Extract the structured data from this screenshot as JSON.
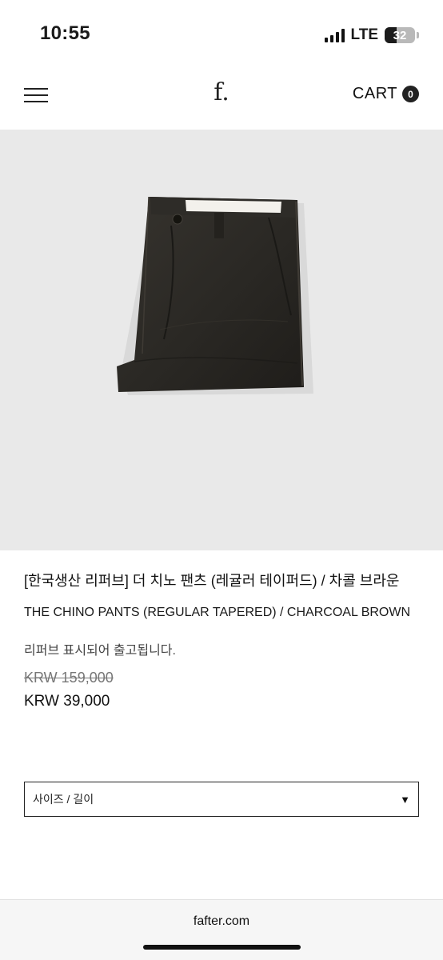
{
  "status_bar": {
    "time": "10:55",
    "network": "LTE",
    "battery": "32"
  },
  "header": {
    "menu_icon": "hamburger-menu-icon",
    "logo": "f.",
    "cart_label": "CART",
    "cart_count": "0"
  },
  "product": {
    "title_ko": "[한국생산 리퍼브] 더 치노 팬츠 (레귤러 테이퍼드) / 차콜 브라운",
    "title_en": "THE CHINO PANTS (REGULAR TAPERED) / CHARCOAL BROWN",
    "notice": "리퍼브 표시되어 출고됩니다.",
    "original_price": "KRW 159,000",
    "sale_price": "KRW 39,000",
    "option_select": {
      "label": "사이즈 / 길이",
      "arrow": "▼"
    }
  },
  "footer": {
    "domain": "fafter.com"
  },
  "colors": {
    "image_background": "#e9e9e9",
    "pants": "#2b2925",
    "accent": "#222222"
  }
}
